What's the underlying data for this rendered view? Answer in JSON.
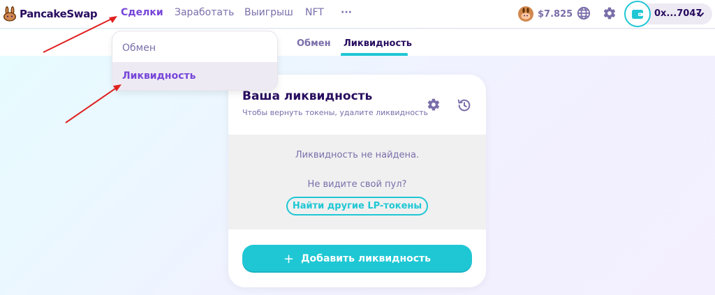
{
  "brand": {
    "name": "PancakeSwap",
    "logo_icon": "bunny-logo-icon"
  },
  "nav": {
    "items": [
      {
        "label": "Сделки",
        "active": true
      },
      {
        "label": "Заработать",
        "active": false
      },
      {
        "label": "Выигрыш",
        "active": false
      },
      {
        "label": "NFT",
        "active": false
      },
      {
        "label": "···",
        "active": false
      }
    ]
  },
  "header": {
    "cake_price": "$7.825",
    "wallet_address": "0x...7047"
  },
  "dropdown": {
    "items": [
      {
        "label": "Обмен"
      },
      {
        "label": "Ликвидность",
        "highlighted": true
      }
    ]
  },
  "subnav": {
    "tabs": [
      {
        "label": "Обмен"
      },
      {
        "label": "Ликвидность",
        "active": true
      }
    ]
  },
  "card": {
    "title": "Ваша ликвидность",
    "subtitle": "Чтобы вернуть токены, удалите ликвидность",
    "empty_text": "Ликвидность не найдена.",
    "no_pool_text": "Не видите свой пул?",
    "find_lp_button": "Найти другие LP-токены",
    "add_button": "Добавить ликвидность",
    "add_icon": "+"
  },
  "colors": {
    "primary": "#1fc7d4",
    "secondary": "#7645d9",
    "text": "#280d5f",
    "text_subtle": "#7a6eaa",
    "annotation": "#e02020"
  }
}
